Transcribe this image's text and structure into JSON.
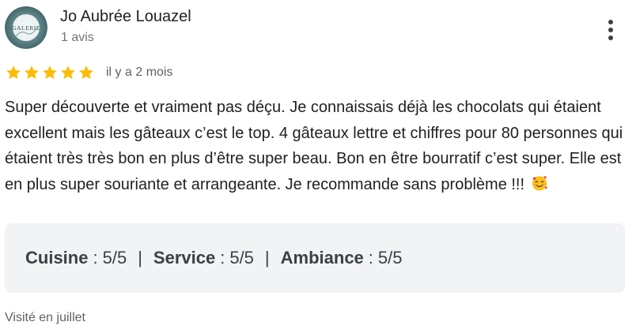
{
  "author": {
    "name": "Jo Aubrée Louazel",
    "review_count": "1 avis",
    "avatar_text": "GALERIE"
  },
  "menu": {
    "icon": "more-vert-icon"
  },
  "rating": {
    "stars": 5,
    "max_stars": 5,
    "star_color": "#fbbc04",
    "relative_date": "il y a 2 mois"
  },
  "review": {
    "text": "Super découverte et vraiment pas déçu. Je connaissais déjà les chocolats qui étaient excellent mais les gâteaux c’est le top. 4 gâteaux lettre et chiffres pour 80 personnes qui étaient très très bon en plus d’être super beau. Bon en être bourratif c’est super. Elle est en plus super souriante et arrangeante. Je recommande sans problème !!!",
    "emoji": "smiling-face-with-hearts-icon"
  },
  "category_ratings": [
    {
      "name": "Cuisine",
      "value": "5/5"
    },
    {
      "name": "Service",
      "value": "5/5"
    },
    {
      "name": "Ambiance",
      "value": "5/5"
    }
  ],
  "visit": {
    "text": "Visité en juillet"
  }
}
